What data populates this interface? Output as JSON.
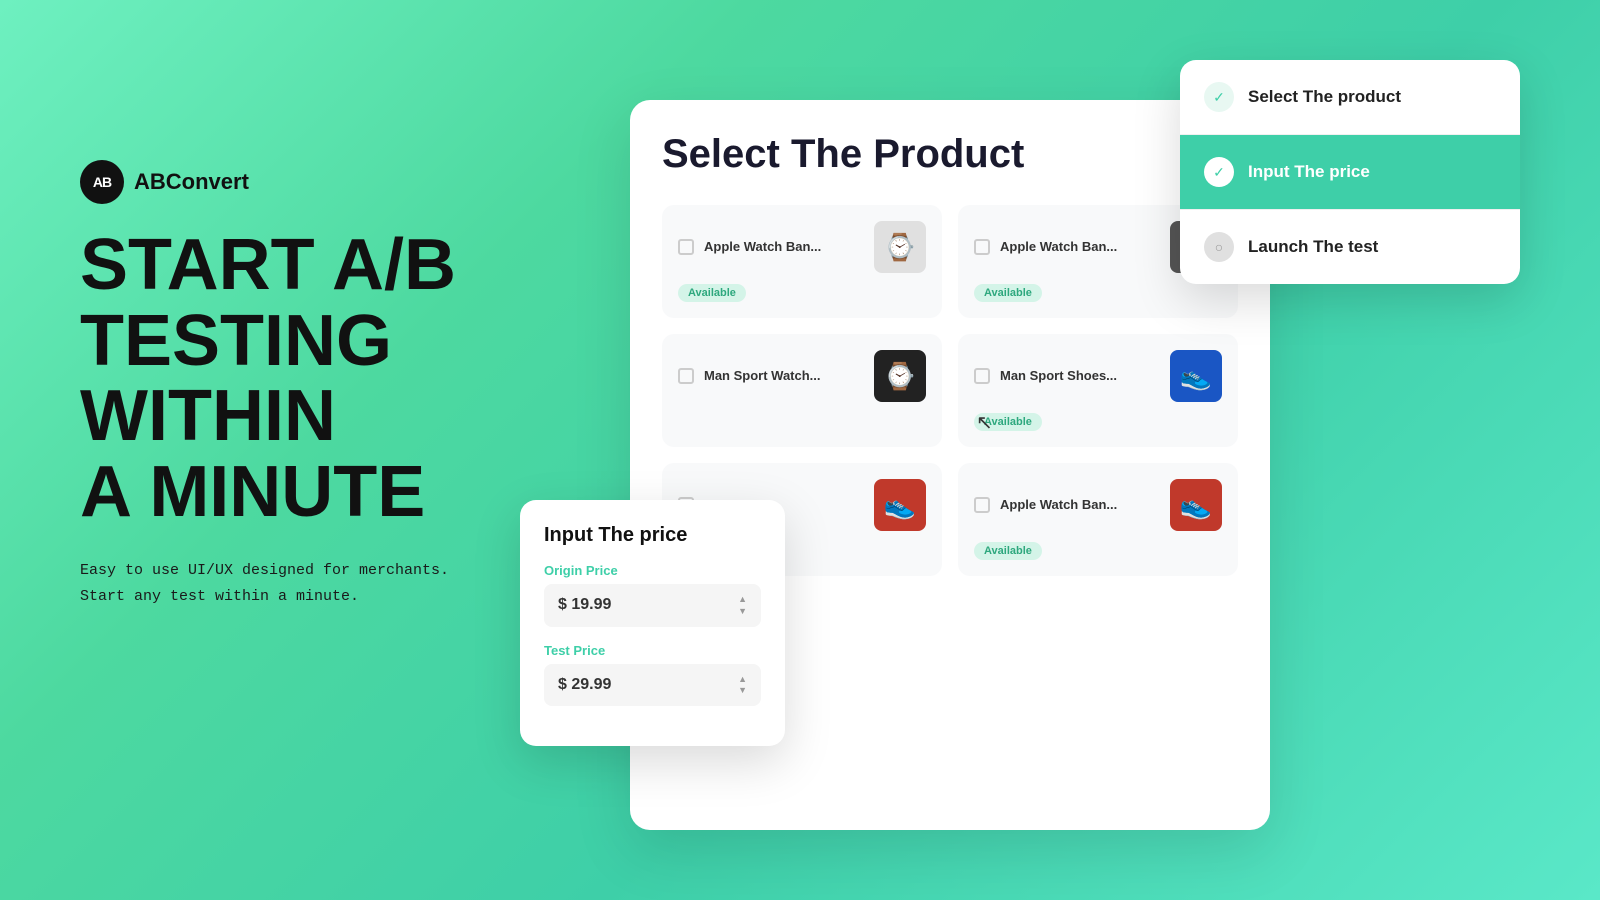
{
  "brand": {
    "logo_text": "AB",
    "name": "ABConvert"
  },
  "headline": {
    "line1": "START A/B",
    "line2": "TESTING",
    "line3": "WITHIN",
    "line4": "A MINUTE"
  },
  "subtext": "Easy to use UI/UX designed for merchants.\nStart any test within a minute.",
  "main_card": {
    "title": "Select The  Product"
  },
  "products": [
    {
      "name": "Apple Watch Ban...",
      "badge": "Available",
      "emoji": "⌚"
    },
    {
      "name": "Apple Watch Ban...",
      "badge": "Available",
      "emoji": "⌚"
    },
    {
      "name": "Man Sport Watch...",
      "badge": "",
      "emoji": "⌚"
    },
    {
      "name": "Man Sport Shoes...",
      "badge": "Available",
      "emoji": "👟"
    },
    {
      "name": "...",
      "badge": "",
      "emoji": "👟"
    },
    {
      "name": "Apple Watch Ban...",
      "badge": "Available",
      "emoji": "👟"
    }
  ],
  "price_card": {
    "title": "Input The price",
    "origin_label": "Origin Price",
    "origin_value": "$ 19.99",
    "test_label": "Test Price",
    "test_value": "$ 29.99"
  },
  "steps": [
    {
      "label": "Select The product",
      "state": "done"
    },
    {
      "label": "Input The price",
      "state": "active"
    },
    {
      "label": "Launch The test",
      "state": "pending"
    }
  ]
}
